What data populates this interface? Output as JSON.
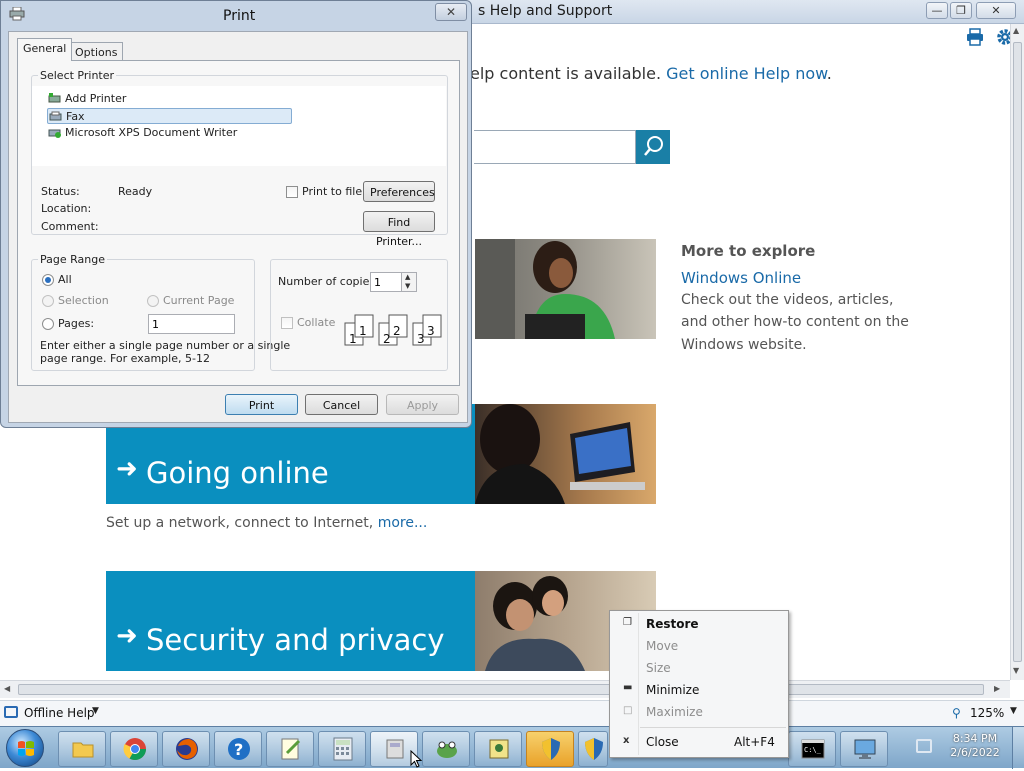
{
  "help_window": {
    "title": "s Help and Support",
    "notice_text": "elp content is available.",
    "notice_link": "Get online Help now",
    "notice_period": ".",
    "more_to_explore": "More to explore",
    "windows_online_link": "Windows Online",
    "explore_lines": [
      "Check out the videos, articles,",
      "and other how-to content on the",
      "Windows website."
    ],
    "tiles": [
      {
        "label": "Going online",
        "desc": "Set up a network, connect to Internet,",
        "desc_link": "more..."
      },
      {
        "label": "Security and privacy"
      }
    ],
    "status_left": "Offline Help",
    "zoom": "125%",
    "colors": {
      "accent": "#0a8fbf",
      "link": "#1a6aa8"
    }
  },
  "print_dialog": {
    "title": "Print",
    "tabs": [
      "General",
      "Options"
    ],
    "select_printer_label": "Select Printer",
    "printers": [
      "Add Printer",
      "Fax",
      "Microsoft XPS Document Writer"
    ],
    "selected_printer": "Fax",
    "status_label": "Status:",
    "status_value": "Ready",
    "location_label": "Location:",
    "comment_label": "Comment:",
    "print_to_file": "Print to file",
    "preferences": "Preferences",
    "find_printer": "Find Printer...",
    "page_range_label": "Page Range",
    "range_all": "All",
    "range_selection": "Selection",
    "range_current": "Current Page",
    "range_pages": "Pages:",
    "pages_value": "1",
    "range_hint_1": "Enter either a single page number or a single",
    "range_hint_2": "page range.  For example, 5-12",
    "copies_label": "Number of copies:",
    "copies_value": "1",
    "collate": "Collate",
    "collate_numbers": [
      "1",
      "1",
      "2",
      "2",
      "3",
      "3"
    ],
    "buttons": {
      "print": "Print",
      "cancel": "Cancel",
      "apply": "Apply"
    }
  },
  "context_menu": {
    "items": [
      {
        "label": "Restore",
        "icon": "restore-icon",
        "enabled": true
      },
      {
        "label": "Move",
        "enabled": false
      },
      {
        "label": "Size",
        "enabled": false
      },
      {
        "label": "Minimize",
        "icon": "minimize-icon",
        "enabled": true
      },
      {
        "label": "Maximize",
        "icon": "maximize-icon",
        "enabled": false
      },
      {
        "label": "Close",
        "icon": "close-icon",
        "shortcut": "Alt+F4",
        "enabled": true
      }
    ]
  },
  "taskbar": {
    "apps": [
      "start-orb",
      "file-explorer",
      "chrome",
      "firefox",
      "help",
      "notepad-plus-plus",
      "calculator",
      "print-app",
      "frog-app",
      "image-viewer",
      "security-shield",
      "security-shield-2",
      "command-prompt",
      "remote-desktop"
    ],
    "time": "8:34 PM",
    "date": "2/6/2022"
  }
}
